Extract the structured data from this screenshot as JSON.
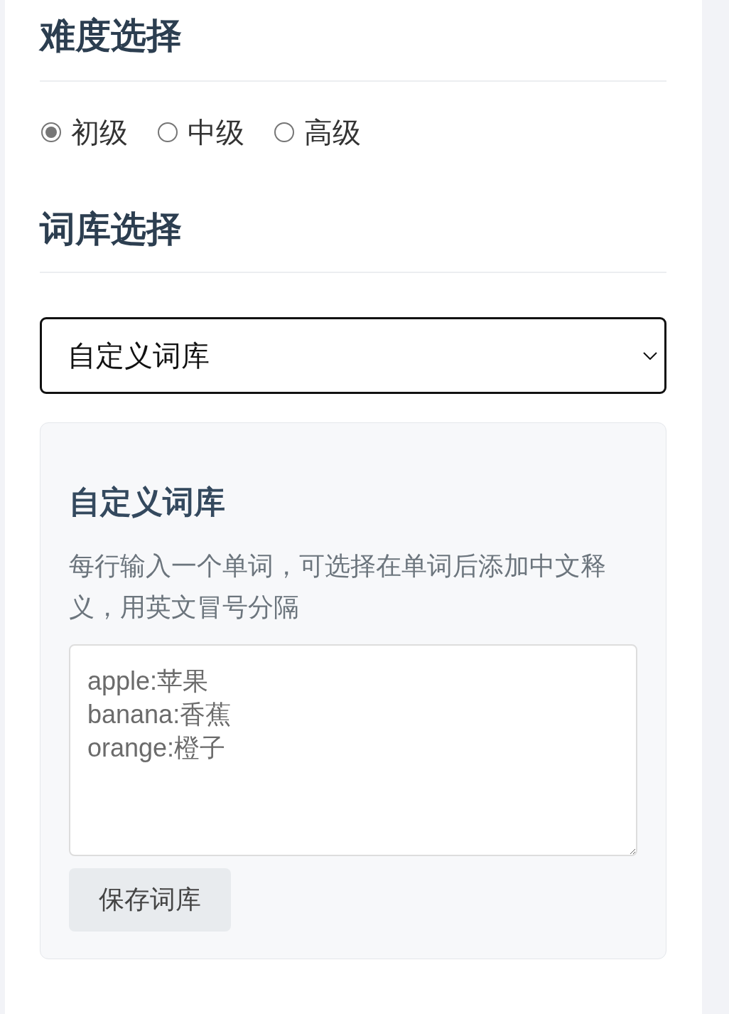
{
  "difficulty": {
    "title": "难度选择",
    "options": [
      {
        "label": "初级",
        "selected": true
      },
      {
        "label": "中级",
        "selected": false
      },
      {
        "label": "高级",
        "selected": false
      }
    ]
  },
  "library": {
    "title": "词库选择",
    "select": {
      "value": "自定义词库"
    },
    "custom_library": {
      "title": "自定义词库",
      "description": "每行输入一个单词，可选择在单词后添加中文释义，用英文冒号分隔",
      "textarea": {
        "value": "apple:苹果\nbanana:香蕉\norange:橙子"
      },
      "button": "保存词库"
    }
  }
}
